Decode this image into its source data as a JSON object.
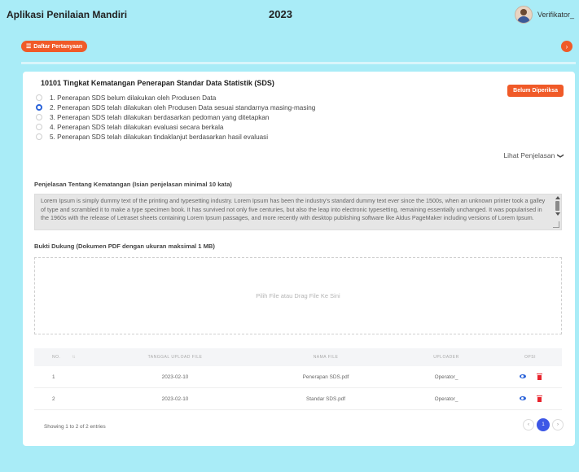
{
  "header": {
    "app_title": "Aplikasi Penilaian Mandiri",
    "year": "2023",
    "user_name": "Verifikator_"
  },
  "toolbar": {
    "daftar_label": "Daftar Pertanyaan",
    "daftar_icon": "☰",
    "next_icon": "›"
  },
  "question": {
    "title": "10101 Tingkat Kematangan Penerapan Standar Data Statistik (SDS)",
    "status_badge": "Belum Diperiksa",
    "options": [
      "1. Penerapan SDS belum dilakukan oleh Produsen Data",
      "2. Penerapan SDS telah dilakukan oleh Produsen Data sesuai standarnya masing-masing",
      "3. Penerapan SDS telah dilakukan berdasarkan pedoman yang ditetapkan",
      "4. Penerapan SDS telah dilakukan evaluasi secara berkala",
      "5. Penerapan SDS telah dilakukan tindaklanjut berdasarkan hasil evaluasi"
    ],
    "selected_option_index": 1,
    "lihat_label": "Lihat Penjelasan"
  },
  "penjelasan": {
    "label": "Penjelasan Tentang Kematangan (Isian penjelasan minimal 10 kata)",
    "text": "Lorem Ipsum is simply dummy text of the printing and typesetting industry. Lorem Ipsum has been the industry's standard dummy text ever since the 1500s, when an unknown printer took a galley of type and scrambled it to make a type specimen book. It has survived not only five centuries, but also the leap into electronic typesetting, remaining essentially unchanged. It was popularised in the 1960s with the release of Letraset sheets containing Lorem Ipsum passages, and more recently with desktop publishing software like Aldus PageMaker including versions of Lorem Ipsum."
  },
  "bukti": {
    "label": "Bukti Dukung (Dokumen PDF dengan ukuran maksimal 1 MB)",
    "dropzone_text": "Pilih File atau Drag File Ke Sini"
  },
  "table": {
    "headers": [
      "NO.",
      "TANGGAL UPLOAD FILE",
      "NAMA FILE",
      "UPLOADER",
      "OPSI"
    ],
    "rows": [
      {
        "no": "1",
        "tanggal": "2023-02-10",
        "nama": "Penerapan SDS.pdf",
        "uploader": "Operator_"
      },
      {
        "no": "2",
        "tanggal": "2023-02-10",
        "nama": "Standar SDS.pdf",
        "uploader": "Operator_"
      }
    ],
    "showing": "Showing 1 to 2 of 2 entries",
    "pager": {
      "prev": "‹",
      "current": "1",
      "next": "›"
    }
  },
  "colors": {
    "background": "#a9ecf7",
    "accent_orange": "#f05a28",
    "primary_blue": "#2b63d9",
    "delete_red": "#e8232c"
  },
  "icons": {
    "user": "avatar-icon",
    "list": "list-icon",
    "next": "chevron-right-icon",
    "lihat": "chevron-down-icon",
    "view": "eye-icon",
    "delete": "trash-icon"
  }
}
